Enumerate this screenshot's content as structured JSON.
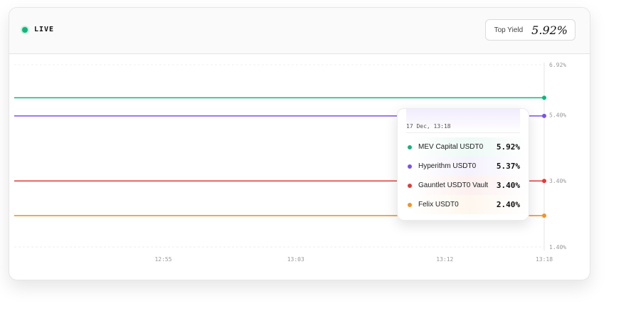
{
  "header": {
    "live_label": "LIVE",
    "top_yield_label": "Top Yield",
    "top_yield_value": "5.92%"
  },
  "colors": {
    "live": "#10b57d",
    "mev": "#10b57d",
    "hyperithm": "#7b52e6",
    "gauntlet": "#e23b3b",
    "felix": "#f29325"
  },
  "tooltip": {
    "date": "17 Dec, 13:18",
    "rows": [
      {
        "name": "MEV Capital USDT0",
        "value": "5.92%",
        "color": "#10b57d"
      },
      {
        "name": "Hyperithm USDT0",
        "value": "5.37%",
        "color": "#7b52e6"
      },
      {
        "name": "Gauntlet USDT0 Vault",
        "value": "3.40%",
        "color": "#e23b3b"
      },
      {
        "name": "Felix USDT0",
        "value": "2.40%",
        "color": "#f29325"
      }
    ]
  },
  "chart_data": {
    "type": "line",
    "x_ticks": [
      "12:55",
      "13:03",
      "13:12",
      "13:18"
    ],
    "y_ticks": [
      "6.92%",
      "5.40%",
      "3.40%",
      "1.40%"
    ],
    "ylim": [
      1.4,
      6.92
    ],
    "xlim": [
      "12:46",
      "13:18"
    ],
    "grid": true,
    "series": [
      {
        "name": "MEV Capital USDT0",
        "color": "#10b57d",
        "x": [
          "12:46",
          "13:18"
        ],
        "values": [
          5.92,
          5.92
        ]
      },
      {
        "name": "Hyperithm USDT0",
        "color": "#7b52e6",
        "x": [
          "12:46",
          "13:18"
        ],
        "values": [
          5.37,
          5.37
        ]
      },
      {
        "name": "Gauntlet USDT0 Vault",
        "color": "#e23b3b",
        "x": [
          "12:46",
          "13:18"
        ],
        "values": [
          3.4,
          3.4
        ]
      },
      {
        "name": "Felix USDT0",
        "color": "#f29325",
        "x": [
          "12:46",
          "13:18"
        ],
        "values": [
          2.35,
          2.35
        ]
      }
    ]
  }
}
